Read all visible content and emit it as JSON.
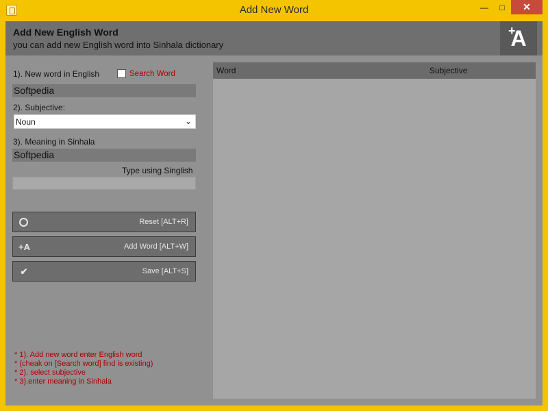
{
  "window": {
    "title": "Add New Word",
    "controls": {
      "minimize": "—",
      "maximize": "□",
      "close": "✕"
    }
  },
  "header": {
    "title": "Add New English Word",
    "subtitle": "you can add new English word into Sinhala dictionary",
    "logo_icon": "add-word-icon"
  },
  "form": {
    "english_label": "1). New word in English",
    "search_word_label": "Search Word",
    "search_word_checked": false,
    "english_value": "Softpedia",
    "subjective_label": "2). Subjective:",
    "subjective_selected": "Noun",
    "meaning_label": "3). Meaning in Sinhala",
    "meaning_value": "Softpedia",
    "singlish_label": "Type using Singlish",
    "singlish_value": ""
  },
  "buttons": [
    {
      "label": "Reset [ALT+R]",
      "icon": "reset-icon"
    },
    {
      "label": "Add Word [ALT+W]",
      "icon": "add-word-icon"
    },
    {
      "label": "Save [ALT+S]",
      "icon": "checkmark-icon"
    }
  ],
  "notes": [
    "* 1). Add new word enter English word",
    "* (cheak on [Search word] find is existing)",
    "* 2). select subjective",
    "* 3).enter meaning in Sinhala"
  ],
  "list": {
    "columns": [
      "Word",
      "Subjective"
    ],
    "rows": []
  },
  "colors": {
    "title_bar": "#f4c400",
    "panel": "#919191",
    "header": "#6f6f6f",
    "accent_red": "#b00000"
  }
}
